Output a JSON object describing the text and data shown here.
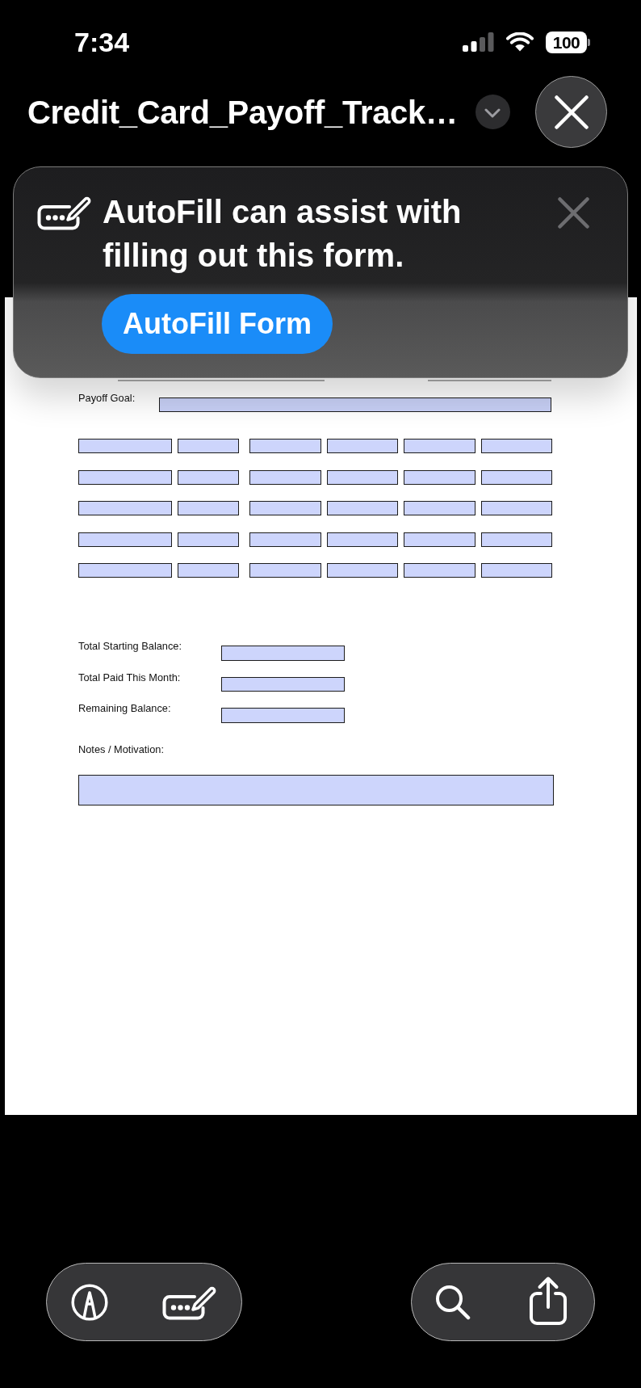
{
  "status_bar": {
    "time": "7:34",
    "battery": "100"
  },
  "header": {
    "title": "Credit_Card_Payoff_Track…"
  },
  "autofill_banner": {
    "message": "AutoFill can assist with filling out this form.",
    "button": "AutoFill Form"
  },
  "document": {
    "covered_fields": [
      {
        "kind": "long"
      },
      {
        "kind": "short"
      }
    ],
    "payoff_goal": {
      "label": "Payoff Goal:"
    },
    "entry_grid": {
      "rows": [
        [
          {
            "kind": "wide"
          },
          {
            "kind": "narrow"
          },
          {
            "kind": "medium"
          },
          {
            "kind": "medium"
          },
          {
            "kind": "medium"
          },
          {
            "kind": "medium"
          }
        ],
        [
          {
            "kind": "wide"
          },
          {
            "kind": "narrow"
          },
          {
            "kind": "medium"
          },
          {
            "kind": "medium"
          },
          {
            "kind": "medium"
          },
          {
            "kind": "medium"
          }
        ],
        [
          {
            "kind": "wide"
          },
          {
            "kind": "narrow"
          },
          {
            "kind": "medium"
          },
          {
            "kind": "medium"
          },
          {
            "kind": "medium"
          },
          {
            "kind": "medium"
          }
        ],
        [
          {
            "kind": "wide"
          },
          {
            "kind": "narrow"
          },
          {
            "kind": "medium"
          },
          {
            "kind": "medium"
          },
          {
            "kind": "medium"
          },
          {
            "kind": "medium"
          }
        ],
        [
          {
            "kind": "wide"
          },
          {
            "kind": "narrow"
          },
          {
            "kind": "medium"
          },
          {
            "kind": "medium"
          },
          {
            "kind": "medium"
          },
          {
            "kind": "medium"
          }
        ]
      ]
    },
    "totals": [
      {
        "label": "Total Starting Balance:"
      },
      {
        "label": "Total Paid This Month:"
      },
      {
        "label": "Remaining Balance:"
      }
    ],
    "notes": {
      "label": "Notes / Motivation:"
    }
  },
  "toolbar": {
    "left": [
      {
        "kind": "markup"
      },
      {
        "kind": "autofill"
      }
    ],
    "right": [
      {
        "kind": "search"
      },
      {
        "kind": "share"
      }
    ]
  }
}
